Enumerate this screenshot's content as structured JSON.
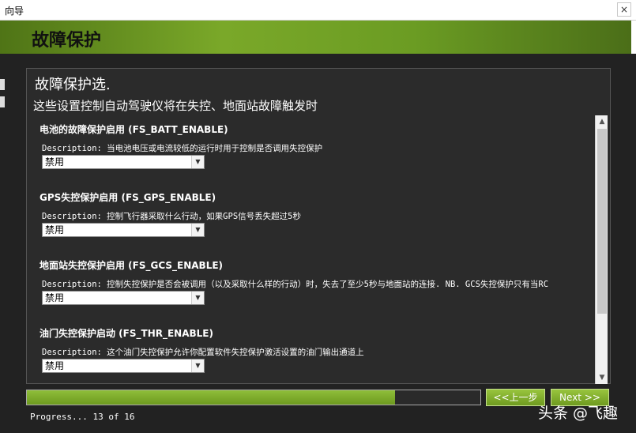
{
  "window": {
    "title": "向导",
    "close_glyph": "×"
  },
  "header": {
    "title": "故障保护"
  },
  "panel": {
    "title": "故障保护选.",
    "description": "这些设置控制自动驾驶仪将在失控、地面站故障触发时"
  },
  "items": [
    {
      "label": "电池的故障保护启用 (FS_BATT_ENABLE)",
      "description": "Description: 当电池电压或电流较低的运行时用于控制是否调用失控保护",
      "value": "禁用"
    },
    {
      "label": "GPS失控保护启用 (FS_GPS_ENABLE)",
      "description": "Description: 控制飞行器采取什么行动，如果GPS信号丢失超过5秒",
      "value": "禁用"
    },
    {
      "label": "地面站失控保护启用 (FS_GCS_ENABLE)",
      "description": "Description: 控制失控保护是否会被调用（以及采取什么样的行动）时，失去了至少5秒与地面站的连接. NB. GCS失控保护只有当RC",
      "value": "禁用"
    },
    {
      "label": "油门失控保护启动 (FS_THR_ENABLE)",
      "description": "Description: 这个油门失控保护允许你配置软件失控保护激活设置的油门输出通道上",
      "value": "禁用"
    }
  ],
  "progress": {
    "current": 13,
    "total": 16,
    "text": "Progress... 13 of 16"
  },
  "buttons": {
    "back": "<<上一步",
    "next": "Next >>"
  },
  "watermark": "头条 @飞趣",
  "colors": {
    "accent": "#7aa829",
    "background": "#262626"
  }
}
